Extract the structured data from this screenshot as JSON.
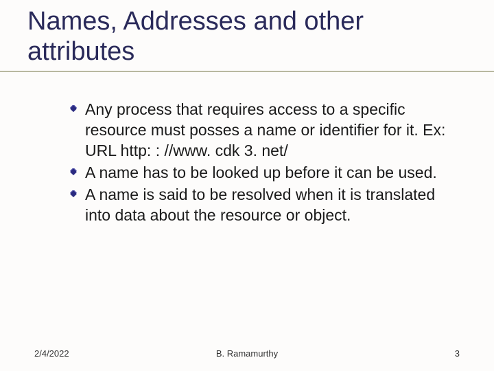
{
  "slide": {
    "title": "Names, Addresses and other attributes",
    "bullets": [
      "Any process that requires access to a specific resource must posses a name or identifier for it. Ex: URL http: : //www. cdk 3. net/",
      "A name has to be looked up before it can be used.",
      "A name is said to be resolved when it is translated into data about the resource or object."
    ],
    "footer": {
      "date": "2/4/2022",
      "author": "B. Ramamurthy",
      "page": "3"
    }
  }
}
